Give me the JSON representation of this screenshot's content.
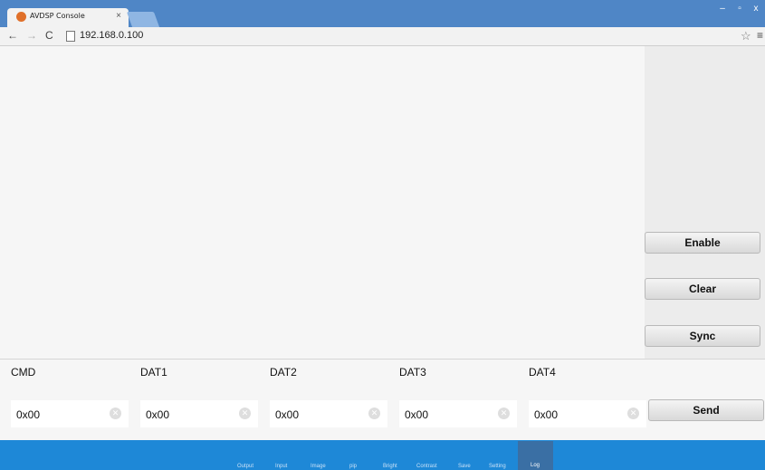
{
  "browser": {
    "tab_title": "AVDSP Console",
    "tab_close": "×",
    "url": "192.168.0.100",
    "window_min": "–",
    "window_max": "▫",
    "window_close": "x"
  },
  "side_buttons": {
    "enable": "Enable",
    "clear": "Clear",
    "sync": "Sync"
  },
  "fields": [
    {
      "label": "CMD",
      "value": "0x00"
    },
    {
      "label": "DAT1",
      "value": "0x00"
    },
    {
      "label": "DAT2",
      "value": "0x00"
    },
    {
      "label": "DAT3",
      "value": "0x00"
    },
    {
      "label": "DAT4",
      "value": "0x00"
    }
  ],
  "send_label": "Send",
  "nav": {
    "items": [
      "Output",
      "Input",
      "Image",
      "pip",
      "Bright",
      "Contrast",
      "Save",
      "Setting"
    ],
    "active": "Log"
  },
  "colors": {
    "titlebar": "#4f86c6",
    "bottom_nav": "#1e88d7",
    "active_nav": "#3a6fa4"
  }
}
